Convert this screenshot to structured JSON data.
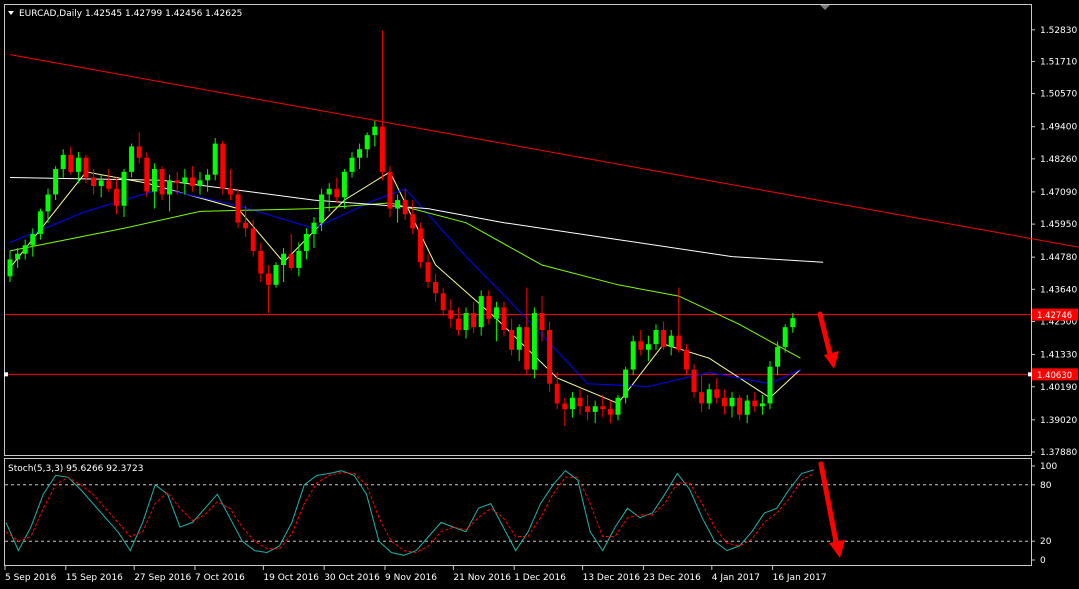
{
  "header": {
    "symbol_line": "EURCAD,Daily  1.42545 1.42799 1.42456 1.42625"
  },
  "stoch_header": "Stoch(5,3,3) 95.6266 92.3723",
  "colors": {
    "background": "#000000",
    "bull": "#00ff00",
    "bear": "#ff0000",
    "trendline": "#ff0000",
    "hline": "#ff0000",
    "ma_fast": "#ffff99",
    "ma_mid": "#0000ff",
    "ma_slow": "#7fff00",
    "ma_long": "#ffffff",
    "stoch_main": "#20b2aa",
    "stoch_signal": "#ff0000",
    "arrow": "#ff0000",
    "text": "#ffffff"
  },
  "chart_data": [
    {
      "type": "candlestick",
      "symbol": "EURCAD",
      "timeframe": "Daily",
      "ylim": [
        1.3788,
        1.53
      ],
      "y_ticks": [
        "1.52830",
        "1.51710",
        "1.50570",
        "1.49400",
        "1.48260",
        "1.47090",
        "1.45950",
        "1.44780",
        "1.43640",
        "1.42500",
        "1.41330",
        "1.40190",
        "1.39020",
        "1.37880"
      ],
      "x_ticks": [
        "5 Sep 2016",
        "15 Sep 2016",
        "27 Sep 2016",
        "7 Oct 2016",
        "19 Oct 2016",
        "30 Oct 2016",
        "9 Nov 2016",
        "21 Nov 2016",
        "1 Dec 2016",
        "13 Dec 2016",
        "23 Dec 2016",
        "4 Jan 2017",
        "16 Jan 2017"
      ],
      "x_tick_index": [
        0,
        8,
        17,
        25,
        34,
        42,
        50,
        59,
        67,
        76,
        84,
        93,
        101
      ],
      "price_tags": [
        "1.42746",
        "1.40630"
      ],
      "horizontal_lines": [
        1.4275,
        1.4063
      ],
      "trendline": {
        "from": [
          0,
          1.5195
        ],
        "to": [
          144,
          1.4497
        ]
      },
      "ohlc": [
        [
          1.441,
          1.45,
          1.439,
          1.447
        ],
        [
          1.447,
          1.451,
          1.444,
          1.449
        ],
        [
          1.449,
          1.454,
          1.447,
          1.452
        ],
        [
          1.452,
          1.458,
          1.448,
          1.456
        ],
        [
          1.456,
          1.465,
          1.454,
          1.464
        ],
        [
          1.464,
          1.472,
          1.46,
          1.47
        ],
        [
          1.47,
          1.48,
          1.468,
          1.479
        ],
        [
          1.479,
          1.486,
          1.476,
          1.484
        ],
        [
          1.484,
          1.487,
          1.477,
          1.478
        ],
        [
          1.478,
          1.485,
          1.474,
          1.483
        ],
        [
          1.483,
          1.484,
          1.474,
          1.476
        ],
        [
          1.476,
          1.479,
          1.47,
          1.473
        ],
        [
          1.473,
          1.477,
          1.469,
          1.475
        ],
        [
          1.475,
          1.479,
          1.471,
          1.472
        ],
        [
          1.472,
          1.476,
          1.463,
          1.466
        ],
        [
          1.466,
          1.479,
          1.462,
          1.478
        ],
        [
          1.478,
          1.488,
          1.476,
          1.487
        ],
        [
          1.487,
          1.492,
          1.481,
          1.483
        ],
        [
          1.483,
          1.485,
          1.469,
          1.471
        ],
        [
          1.471,
          1.481,
          1.465,
          1.479
        ],
        [
          1.479,
          1.48,
          1.468,
          1.47
        ],
        [
          1.47,
          1.477,
          1.464,
          1.475
        ],
        [
          1.475,
          1.478,
          1.47,
          1.474
        ],
        [
          1.474,
          1.479,
          1.47,
          1.476
        ],
        [
          1.476,
          1.48,
          1.471,
          1.473
        ],
        [
          1.473,
          1.478,
          1.47,
          1.475
        ],
        [
          1.475,
          1.479,
          1.471,
          1.477
        ],
        [
          1.477,
          1.49,
          1.475,
          1.488
        ],
        [
          1.488,
          1.489,
          1.47,
          1.472
        ],
        [
          1.472,
          1.479,
          1.468,
          1.47
        ],
        [
          1.47,
          1.472,
          1.458,
          1.46
        ],
        [
          1.46,
          1.466,
          1.455,
          1.458
        ],
        [
          1.458,
          1.461,
          1.448,
          1.45
        ],
        [
          1.45,
          1.453,
          1.439,
          1.442
        ],
        [
          1.442,
          1.445,
          1.428,
          1.438
        ],
        [
          1.438,
          1.446,
          1.437,
          1.445
        ],
        [
          1.445,
          1.451,
          1.439,
          1.449
        ],
        [
          1.449,
          1.456,
          1.443,
          1.444
        ],
        [
          1.444,
          1.453,
          1.441,
          1.45
        ],
        [
          1.45,
          1.458,
          1.447,
          1.456
        ],
        [
          1.456,
          1.462,
          1.451,
          1.46
        ],
        [
          1.46,
          1.472,
          1.457,
          1.47
        ],
        [
          1.47,
          1.474,
          1.464,
          1.472
        ],
        [
          1.472,
          1.476,
          1.467,
          1.469
        ],
        [
          1.469,
          1.479,
          1.465,
          1.478
        ],
        [
          1.478,
          1.485,
          1.476,
          1.483
        ],
        [
          1.483,
          1.488,
          1.479,
          1.486
        ],
        [
          1.486,
          1.492,
          1.483,
          1.491
        ],
        [
          1.491,
          1.496,
          1.487,
          1.494
        ],
        [
          1.494,
          1.528,
          1.475,
          1.478
        ],
        [
          1.478,
          1.48,
          1.462,
          1.465
        ],
        [
          1.465,
          1.47,
          1.46,
          1.468
        ],
        [
          1.468,
          1.472,
          1.461,
          1.463
        ],
        [
          1.463,
          1.468,
          1.456,
          1.458
        ],
        [
          1.458,
          1.46,
          1.444,
          1.446
        ],
        [
          1.446,
          1.449,
          1.437,
          1.439
        ],
        [
          1.439,
          1.442,
          1.432,
          1.435
        ],
        [
          1.435,
          1.437,
          1.427,
          1.429
        ],
        [
          1.429,
          1.433,
          1.423,
          1.426
        ],
        [
          1.426,
          1.43,
          1.42,
          1.422
        ],
        [
          1.422,
          1.43,
          1.419,
          1.428
        ],
        [
          1.428,
          1.432,
          1.421,
          1.423
        ],
        [
          1.423,
          1.436,
          1.42,
          1.434
        ],
        [
          1.434,
          1.436,
          1.424,
          1.426
        ],
        [
          1.426,
          1.432,
          1.418,
          1.43
        ],
        [
          1.43,
          1.432,
          1.42,
          1.422
        ],
        [
          1.422,
          1.426,
          1.413,
          1.415
        ],
        [
          1.415,
          1.424,
          1.411,
          1.423
        ],
        [
          1.423,
          1.437,
          1.406,
          1.408
        ],
        [
          1.408,
          1.43,
          1.405,
          1.428
        ],
        [
          1.428,
          1.434,
          1.418,
          1.422
        ],
        [
          1.422,
          1.425,
          1.4,
          1.403
        ],
        [
          1.403,
          1.407,
          1.394,
          1.396
        ],
        [
          1.396,
          1.398,
          1.388,
          1.394
        ],
        [
          1.394,
          1.4,
          1.391,
          1.398
        ],
        [
          1.398,
          1.401,
          1.392,
          1.395
        ],
        [
          1.395,
          1.399,
          1.39,
          1.393
        ],
        [
          1.393,
          1.397,
          1.389,
          1.395
        ],
        [
          1.395,
          1.399,
          1.391,
          1.394
        ],
        [
          1.394,
          1.397,
          1.389,
          1.392
        ],
        [
          1.392,
          1.399,
          1.39,
          1.398
        ],
        [
          1.398,
          1.409,
          1.396,
          1.408
        ],
        [
          1.408,
          1.42,
          1.406,
          1.418
        ],
        [
          1.418,
          1.422,
          1.413,
          1.415
        ],
        [
          1.415,
          1.42,
          1.411,
          1.417
        ],
        [
          1.417,
          1.424,
          1.415,
          1.422
        ],
        [
          1.422,
          1.425,
          1.415,
          1.416
        ],
        [
          1.416,
          1.422,
          1.413,
          1.42
        ],
        [
          1.42,
          1.437,
          1.414,
          1.415
        ],
        [
          1.415,
          1.417,
          1.406,
          1.408
        ],
        [
          1.408,
          1.41,
          1.398,
          1.4
        ],
        [
          1.4,
          1.406,
          1.393,
          1.396
        ],
        [
          1.396,
          1.403,
          1.394,
          1.401
        ],
        [
          1.401,
          1.405,
          1.396,
          1.398
        ],
        [
          1.398,
          1.401,
          1.392,
          1.395
        ],
        [
          1.395,
          1.4,
          1.391,
          1.398
        ],
        [
          1.398,
          1.399,
          1.39,
          1.392
        ],
        [
          1.392,
          1.399,
          1.389,
          1.397
        ],
        [
          1.397,
          1.4,
          1.393,
          1.395
        ],
        [
          1.395,
          1.399,
          1.392,
          1.396
        ],
        [
          1.396,
          1.411,
          1.394,
          1.409
        ],
        [
          1.409,
          1.418,
          1.406,
          1.416
        ],
        [
          1.416,
          1.424,
          1.414,
          1.423
        ],
        [
          1.423,
          1.428,
          1.421,
          1.4262
        ]
      ],
      "moving_averages": [
        {
          "color": "#ffff99",
          "points": [
            [
              0,
              1.444
            ],
            [
              10,
              1.478
            ],
            [
              18,
              1.474
            ],
            [
              30,
              1.465
            ],
            [
              36,
              1.446
            ],
            [
              44,
              1.468
            ],
            [
              50,
              1.478
            ],
            [
              56,
              1.445
            ],
            [
              64,
              1.426
            ],
            [
              72,
              1.405
            ],
            [
              80,
              1.396
            ],
            [
              86,
              1.417
            ],
            [
              92,
              1.412
            ],
            [
              100,
              1.398
            ],
            [
              104,
              1.408
            ]
          ]
        },
        {
          "color": "#0000ff",
          "points": [
            [
              0,
              1.453
            ],
            [
              10,
              1.464
            ],
            [
              20,
              1.472
            ],
            [
              30,
              1.466
            ],
            [
              40,
              1.458
            ],
            [
              48,
              1.468
            ],
            [
              52,
              1.472
            ],
            [
              60,
              1.448
            ],
            [
              68,
              1.426
            ],
            [
              76,
              1.403
            ],
            [
              84,
              1.402
            ],
            [
              92,
              1.407
            ],
            [
              100,
              1.403
            ],
            [
              104,
              1.408
            ]
          ]
        },
        {
          "color": "#7fff00",
          "points": [
            [
              0,
              1.45
            ],
            [
              15,
              1.458
            ],
            [
              25,
              1.464
            ],
            [
              40,
              1.465
            ],
            [
              50,
              1.467
            ],
            [
              60,
              1.46
            ],
            [
              70,
              1.445
            ],
            [
              80,
              1.438
            ],
            [
              88,
              1.434
            ],
            [
              96,
              1.424
            ],
            [
              104,
              1.412
            ]
          ]
        },
        {
          "color": "#ffffff",
          "points": [
            [
              0,
              1.476
            ],
            [
              20,
              1.475
            ],
            [
              40,
              1.468
            ],
            [
              55,
              1.465
            ],
            [
              65,
              1.46
            ],
            [
              80,
              1.454
            ],
            [
              95,
              1.448
            ],
            [
              107,
              1.446
            ]
          ]
        }
      ]
    },
    {
      "type": "line",
      "name": "Stoch(5,3,3)",
      "ylim": [
        0,
        100
      ],
      "y_ticks": [
        "100",
        "80",
        "20",
        "0"
      ],
      "levels": [
        80,
        20
      ],
      "series": [
        {
          "values": [
            40,
            10,
            35,
            70,
            90,
            88,
            75,
            60,
            45,
            30,
            10,
            40,
            80,
            70,
            35,
            40,
            55,
            70,
            45,
            20,
            10,
            8,
            15,
            40,
            80,
            90,
            92,
            95,
            90,
            70,
            20,
            8,
            5,
            10,
            25,
            40,
            35,
            30,
            55,
            60,
            35,
            10,
            30,
            60,
            80,
            95,
            85,
            30,
            10,
            35,
            55,
            45,
            50,
            70,
            92,
            75,
            45,
            20,
            10,
            15,
            30,
            50,
            55,
            75,
            92,
            96
          ]
        },
        {
          "values": [
            30,
            20,
            25,
            55,
            80,
            88,
            80,
            70,
            55,
            40,
            25,
            30,
            60,
            72,
            55,
            42,
            48,
            62,
            55,
            35,
            20,
            12,
            12,
            28,
            60,
            82,
            90,
            93,
            92,
            80,
            45,
            20,
            10,
            8,
            15,
            30,
            35,
            32,
            45,
            55,
            45,
            25,
            25,
            45,
            70,
            88,
            88,
            60,
            25,
            25,
            45,
            48,
            48,
            60,
            82,
            82,
            60,
            35,
            18,
            15,
            22,
            40,
            50,
            65,
            85,
            92
          ]
        }
      ]
    }
  ]
}
